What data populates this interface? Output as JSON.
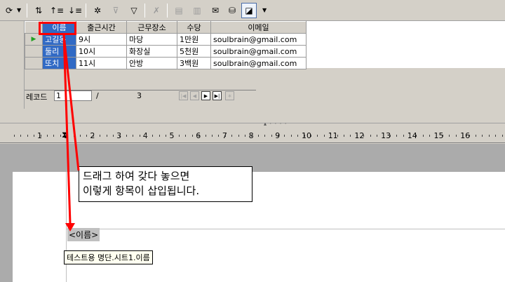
{
  "grid": {
    "columns": [
      "이름",
      "출근시간",
      "근무장소",
      "수당",
      "이메일"
    ],
    "rows": [
      [
        "고길동",
        "9시",
        "마당",
        "1만원",
        "soulbrain@gmail.com"
      ],
      [
        "둘리",
        "10시",
        "화장실",
        "5천원",
        "soulbrain@gmail.com"
      ],
      [
        "또치",
        "11시",
        "안방",
        "3백원",
        "soulbrain@gmail.com"
      ]
    ]
  },
  "record_bar": {
    "label": "레코드",
    "current": "1",
    "slash": "/",
    "total": "3"
  },
  "ruler_labels": [
    "1",
    "1",
    "2",
    "3",
    "4",
    "5",
    "6",
    "7",
    "8",
    "9",
    "10",
    "11",
    "12",
    "13",
    "14",
    "15",
    "16"
  ],
  "annotation": {
    "line1": "드래그 하여 갖다 놓으면",
    "line2": "이렇게 항목이 삽입됩니다."
  },
  "document": {
    "field_text": "<이름>",
    "tooltip_text": "테스트용 명단.시트1.이름"
  },
  "colors": {
    "highlight": "#ff0000",
    "selected_column": "#316ac5",
    "arrow": "#ff0000"
  }
}
